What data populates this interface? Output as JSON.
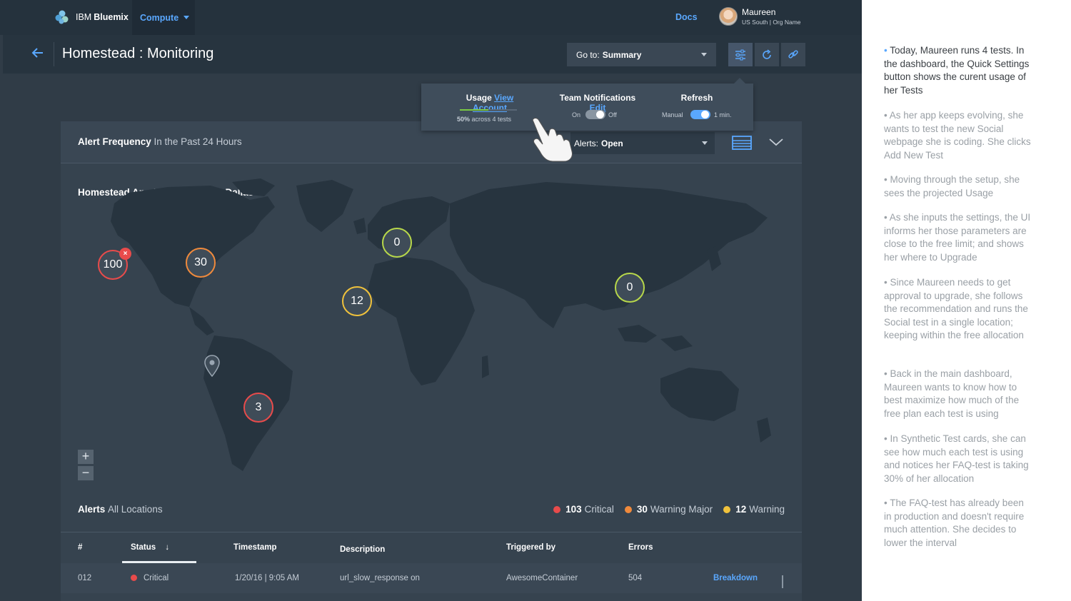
{
  "topbar": {
    "brand_prefix": "IBM",
    "brand_name": "Bluemix",
    "nav_compute": "Compute",
    "docs": "Docs",
    "user_name": "Maureen",
    "user_org": "US South | Org Name"
  },
  "header": {
    "title": "Homestead : Monitoring",
    "goto_label": "Go to:",
    "goto_value": "Summary",
    "buttons": [
      "quick-settings",
      "refresh",
      "link"
    ]
  },
  "quick_settings": {
    "usage_label": "Usage",
    "usage_link": "View Account",
    "usage_percent": 50,
    "usage_percent_text": "50%",
    "usage_caption": "across 4 tests",
    "team_label": "Team Notifications",
    "team_link": "Edit",
    "team_on": "On",
    "team_off": "Off",
    "team_state": "off",
    "refresh_label": "Refresh",
    "refresh_manual": "Manual",
    "refresh_interval": "1 min.",
    "refresh_state": "on"
  },
  "alert_frequency": {
    "title": "Alert Frequency",
    "subtitle": "In the Past 24 Hours",
    "alerts_label": "Alerts:",
    "alerts_value": "Open"
  },
  "map": {
    "title": "Homestead App Running From: Dallas",
    "markers": [
      {
        "label": "100",
        "severity": "critical",
        "has_close": true
      },
      {
        "label": "30",
        "severity": "major"
      },
      {
        "label": "0",
        "severity": "ok"
      },
      {
        "label": "12",
        "severity": "warning"
      },
      {
        "label": "0",
        "severity": "ok"
      },
      {
        "label": "3",
        "severity": "critical"
      }
    ],
    "zoom_in": "+",
    "zoom_out": "−"
  },
  "alerts": {
    "title": "Alerts",
    "subtitle": "All Locations",
    "legend": [
      {
        "count": "103",
        "label": "Critical",
        "color": "#e84b4b"
      },
      {
        "count": "30",
        "label": "Warning Major",
        "color": "#f08a3c"
      },
      {
        "count": "12",
        "label": "Warning",
        "color": "#f0c23c"
      }
    ]
  },
  "table": {
    "headers": [
      "#",
      "Status",
      "Timestamp",
      "Description",
      "Triggered by",
      "Errors"
    ],
    "sort_arrow": "↓",
    "rows": [
      {
        "id": "012",
        "status": "Critical",
        "timestamp": "1/20/16 | 9:05 AM",
        "description": "url_slow_response on",
        "triggered_by": "AwesomeContainer",
        "errors": "504",
        "action": "Breakdown"
      }
    ]
  },
  "colors": {
    "accent": "#5aa8ff",
    "critical": "#e84b4b",
    "major": "#f08a3c",
    "warning": "#f0c23c",
    "ok": "#b8d84a"
  },
  "notes": [
    "Today, Maureen runs 4 tests. In the dashboard, the Quick Settings button shows the curent usage of her Tests",
    "As her app keeps evolving, she wants to test the new Social webpage she is coding. She clicks Add New Test",
    "Moving through the setup, she sees the projected Usage",
    "As she inputs the settings, the UI informs her those parameters are close to the free limit; and shows her where to Upgrade",
    "Since Maureen needs to get approval to upgrade, she follows the recommendation and runs the Social test in a single location; keeping within the free allocation",
    "Back in the main dashboard, Maureen wants to know how to best maximize how much of the free plan each test is using",
    "In Synthetic Test cards, she can see how much each test is using and notices her FAQ-test is taking 30% of her allocation",
    "The FAQ-test has already been in production and doesn't require much attention. She decides to lower the interval"
  ]
}
